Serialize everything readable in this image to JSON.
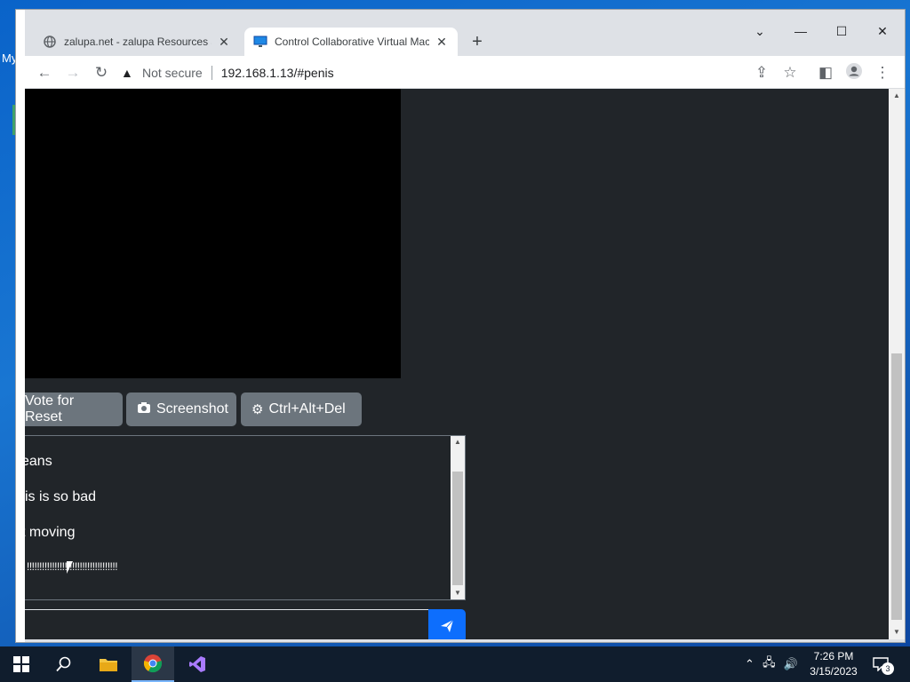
{
  "desktop": {
    "icon_label": "My"
  },
  "browser": {
    "tabs": [
      {
        "title": "zalupa.net - zalupa Resources an",
        "active": false
      },
      {
        "title": "Control Collaborative Virtual Mac",
        "active": true
      }
    ],
    "security_label": "Not secure",
    "url": "192.168.1.13/#penis"
  },
  "vm": {
    "buttons": {
      "vote_reset": "Vote for Reset",
      "screenshot": "Screenshot",
      "ctrl_alt_del": "Ctrl+Alt+Del"
    },
    "chat": {
      "messages": [
        "eans",
        "is is so bad",
        "t moving",
        "!!!!!!!!!!!!!!!!!!!!!!!!!!!!!!!!!!!!"
      ],
      "input_value": ""
    }
  },
  "taskbar": {
    "time": "7:26 PM",
    "date": "3/15/2023",
    "notification_count": "3"
  },
  "colors": {
    "page_bg": "#212529",
    "button_bg": "#6c757d",
    "send_button": "#0d6efd",
    "taskbar_bg": "#101d2d"
  }
}
